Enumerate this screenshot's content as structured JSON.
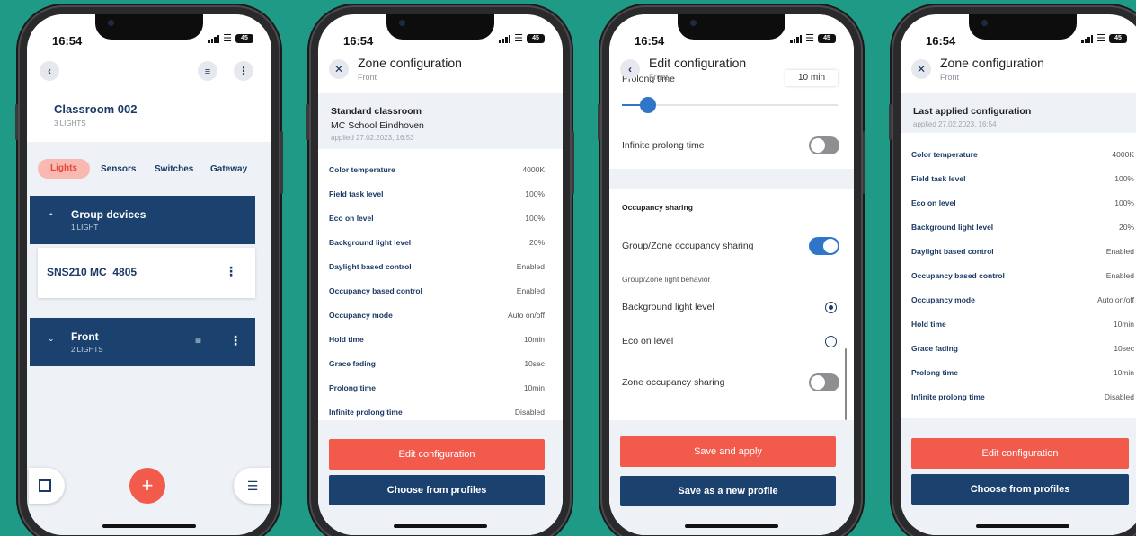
{
  "status_time": "16:54",
  "battery": "45",
  "screen1": {
    "room_title": "Classroom 002",
    "room_sub": "3 LIGHTS",
    "tabs": [
      "Lights",
      "Sensors",
      "Switches",
      "Gateway"
    ],
    "group": {
      "title": "Group devices",
      "sub": "1 LIGHT"
    },
    "device": {
      "name": "SNS210 MC_4805"
    },
    "zone": {
      "title": "Front",
      "sub": "2 LIGHTS"
    }
  },
  "screen2": {
    "title": "Zone configuration",
    "subtitle": "Front",
    "profile_title": "Standard classroom",
    "profile_school": "MC School Eindhoven",
    "profile_applied": "applied 27.02.2023, 16:53",
    "rows": [
      {
        "k": "Color temperature",
        "v": "4000K"
      },
      {
        "k": "Field task level",
        "v": "100%"
      },
      {
        "k": "Eco on level",
        "v": "100%"
      },
      {
        "k": "Background light level",
        "v": "20%"
      },
      {
        "k": "Daylight based control",
        "v": "Enabled"
      },
      {
        "k": "Occupancy based control",
        "v": "Enabled"
      },
      {
        "k": "Occupancy mode",
        "v": "Auto on/off"
      },
      {
        "k": "Hold time",
        "v": "10min"
      },
      {
        "k": "Grace fading",
        "v": "10sec"
      },
      {
        "k": "Prolong time",
        "v": "10min"
      },
      {
        "k": "Infinite prolong time",
        "v": "Disabled"
      }
    ],
    "edit_label": "Edit configuration",
    "profiles_label": "Choose from profiles"
  },
  "screen3": {
    "title": "Edit configuration",
    "subtitle": "Front",
    "prolong_label": "Prolong time",
    "prolong_value": "10 min",
    "prolong_slider_fraction": 0.12,
    "infinite_label": "Infinite prolong time",
    "infinite_on": false,
    "occ_header": "Occupancy sharing",
    "group_sharing_label": "Group/Zone occupancy sharing",
    "group_sharing_on": true,
    "behavior_header": "Group/Zone light behavior",
    "option_bg": "Background light level",
    "option_eco": "Eco on level",
    "selected_option": "Background light level",
    "zone_sharing_label": "Zone occupancy sharing",
    "zone_sharing_on": false,
    "save_apply_label": "Save and apply",
    "save_profile_label": "Save as a new profile"
  },
  "screen4": {
    "title": "Zone configuration",
    "subtitle": "Front",
    "last_title": "Last applied configuration",
    "last_applied": "applied 27.02.2023, 16:54",
    "rows": [
      {
        "k": "Color temperature",
        "v": "4000K"
      },
      {
        "k": "Field task level",
        "v": "100%"
      },
      {
        "k": "Eco on level",
        "v": "100%"
      },
      {
        "k": "Background light level",
        "v": "20%"
      },
      {
        "k": "Daylight based control",
        "v": "Enabled"
      },
      {
        "k": "Occupancy based control",
        "v": "Enabled"
      },
      {
        "k": "Occupancy mode",
        "v": "Auto on/off"
      },
      {
        "k": "Hold time",
        "v": "10min"
      },
      {
        "k": "Grace fading",
        "v": "10sec"
      },
      {
        "k": "Prolong time",
        "v": "10min"
      },
      {
        "k": "Infinite prolong time",
        "v": "Disabled"
      }
    ],
    "edit_label": "Edit configuration",
    "profiles_label": "Choose from profiles"
  },
  "colors": {
    "background": "#1f9a86",
    "navy": "#1b416e",
    "accent_red": "#f25a4c",
    "toggle_on": "#2f75c8"
  }
}
